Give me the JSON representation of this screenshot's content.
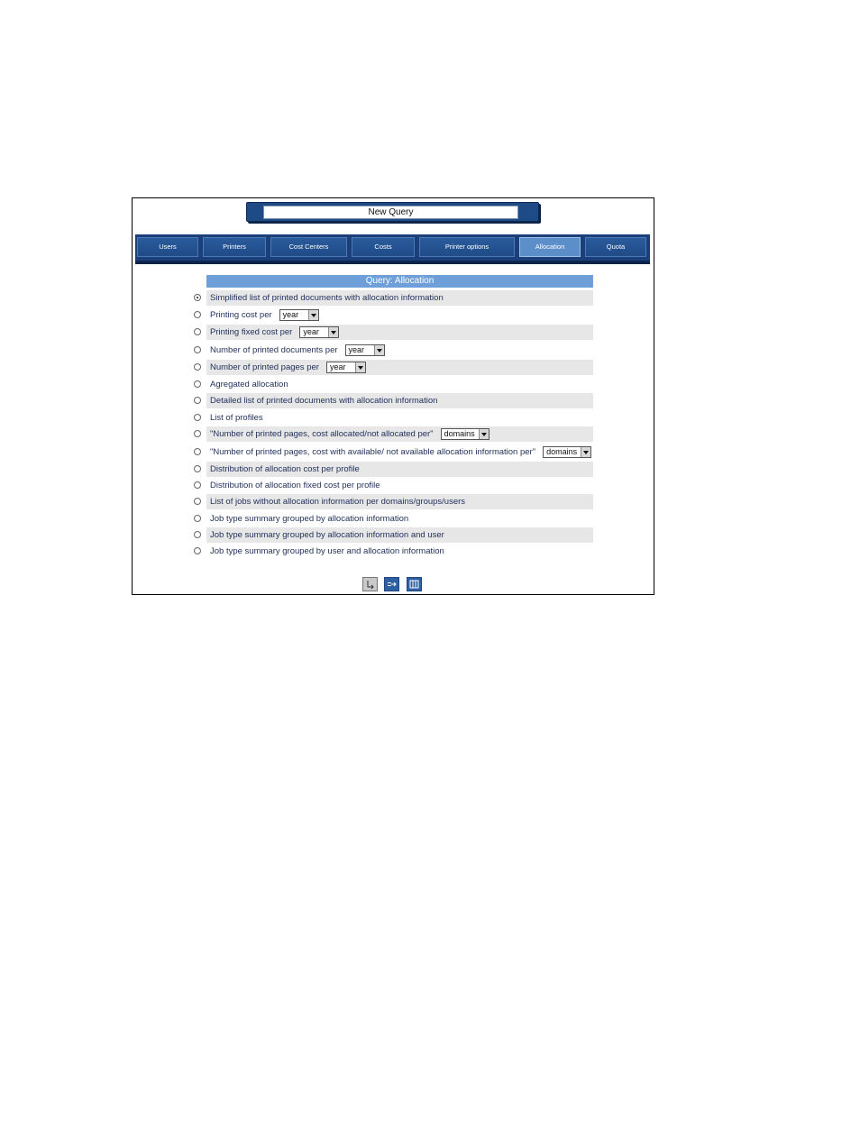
{
  "title": "New Query",
  "tabs": [
    {
      "label": "Users",
      "active": false
    },
    {
      "label": "Printers",
      "active": false
    },
    {
      "label": "Cost Centers",
      "active": false
    },
    {
      "label": "Costs",
      "active": false
    },
    {
      "label": "Printer options",
      "active": false
    },
    {
      "label": "Allocation",
      "active": true
    },
    {
      "label": "Quota",
      "active": false
    }
  ],
  "query": {
    "header": "Query: Allocation",
    "selected_index": 0,
    "options": [
      {
        "label": "Simplified list of printed documents with allocation information"
      },
      {
        "label": "Printing cost per",
        "select": "year"
      },
      {
        "label": "Printing fixed cost per",
        "select": "year"
      },
      {
        "label": "Number of printed documents per",
        "select": "year"
      },
      {
        "label": "Number of printed pages per",
        "select": "year"
      },
      {
        "label": "Agregated allocation"
      },
      {
        "label": "Detailed list of printed documents with allocation information"
      },
      {
        "label": "List of profiles"
      },
      {
        "label": "\"Number of printed pages, cost allocated/not allocated per\"",
        "select": "domains"
      },
      {
        "label": "\"Number of printed pages, cost with available/ not available allocation information per\"",
        "select": "domains"
      },
      {
        "label": "Distribution of allocation cost per profile"
      },
      {
        "label": "Distribution of allocation fixed cost per profile"
      },
      {
        "label": "List of jobs without allocation information per domains/groups/users"
      },
      {
        "label": "Job type summary grouped by allocation information"
      },
      {
        "label": "Job type summary grouped by allocation information and user"
      },
      {
        "label": "Job type summary grouped by user and allocation information"
      }
    ]
  },
  "buttons": [
    {
      "icon": "back-arrow-icon"
    },
    {
      "icon": "execute-arrow-icon"
    },
    {
      "icon": "grid-view-icon"
    }
  ],
  "colors": {
    "nav_blue": "#1b3f78",
    "active_tab": "#5c8fc9",
    "header_blue": "#6f9fd8",
    "row_shade": "#e7e7e7",
    "text": "#1f2f5a"
  }
}
